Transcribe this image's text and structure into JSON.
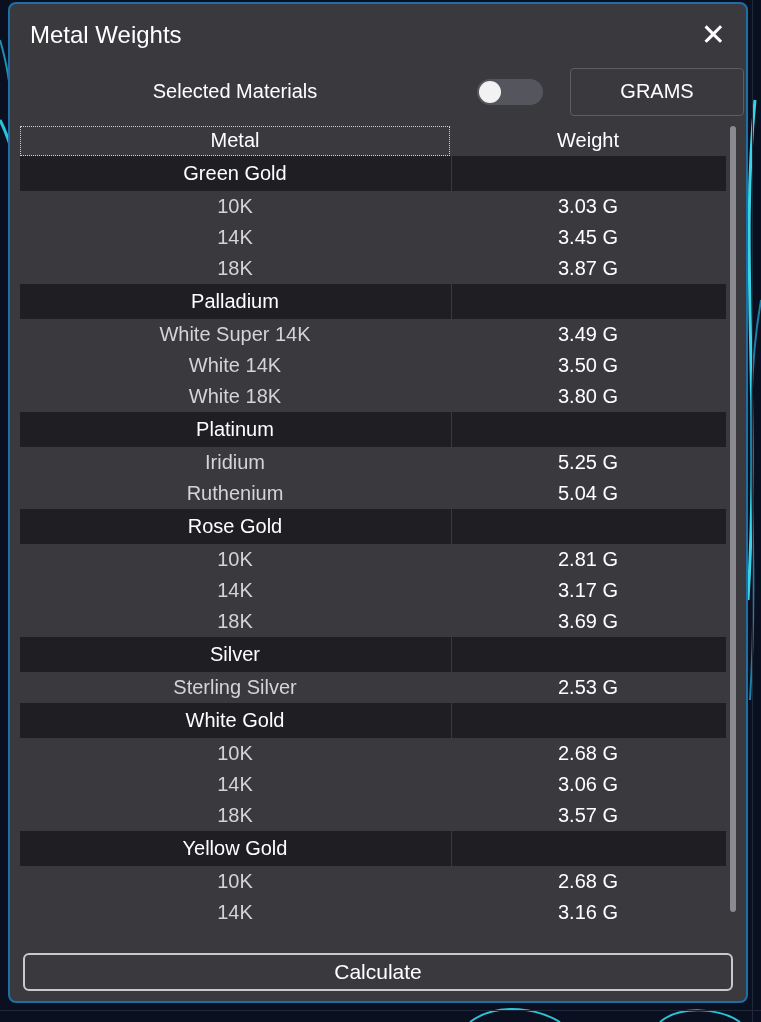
{
  "dialog": {
    "title": "Metal Weights",
    "close": "✕"
  },
  "controls": {
    "toggle_label": "Selected Materials",
    "toggle_on": false,
    "unit_button": "GRAMS"
  },
  "table": {
    "columns": [
      {
        "label": "Metal",
        "focused": true
      },
      {
        "label": "Weight",
        "focused": false
      }
    ],
    "groups": [
      {
        "name": "Green Gold",
        "rows": [
          {
            "metal": "10K",
            "weight": "3.03 G"
          },
          {
            "metal": "14K",
            "weight": "3.45 G"
          },
          {
            "metal": "18K",
            "weight": "3.87 G"
          }
        ]
      },
      {
        "name": "Palladium",
        "rows": [
          {
            "metal": "White Super 14K",
            "weight": "3.49 G"
          },
          {
            "metal": "White 14K",
            "weight": "3.50 G"
          },
          {
            "metal": "White 18K",
            "weight": "3.80 G"
          }
        ]
      },
      {
        "name": "Platinum",
        "rows": [
          {
            "metal": "Iridium",
            "weight": "5.25 G"
          },
          {
            "metal": "Ruthenium",
            "weight": "5.04 G"
          }
        ]
      },
      {
        "name": "Rose Gold",
        "rows": [
          {
            "metal": "10K",
            "weight": "2.81 G"
          },
          {
            "metal": "14K",
            "weight": "3.17 G"
          },
          {
            "metal": "18K",
            "weight": "3.69 G"
          }
        ]
      },
      {
        "name": "Silver",
        "rows": [
          {
            "metal": "Sterling Silver",
            "weight": "2.53 G"
          }
        ]
      },
      {
        "name": "White Gold",
        "rows": [
          {
            "metal": "10K",
            "weight": "2.68 G"
          },
          {
            "metal": "14K",
            "weight": "3.06 G"
          },
          {
            "metal": "18K",
            "weight": "3.57 G"
          }
        ]
      },
      {
        "name": "Yellow Gold",
        "rows": [
          {
            "metal": "10K",
            "weight": "2.68 G"
          },
          {
            "metal": "14K",
            "weight": "3.16 G"
          }
        ]
      }
    ]
  },
  "calculate_button": "Calculate"
}
